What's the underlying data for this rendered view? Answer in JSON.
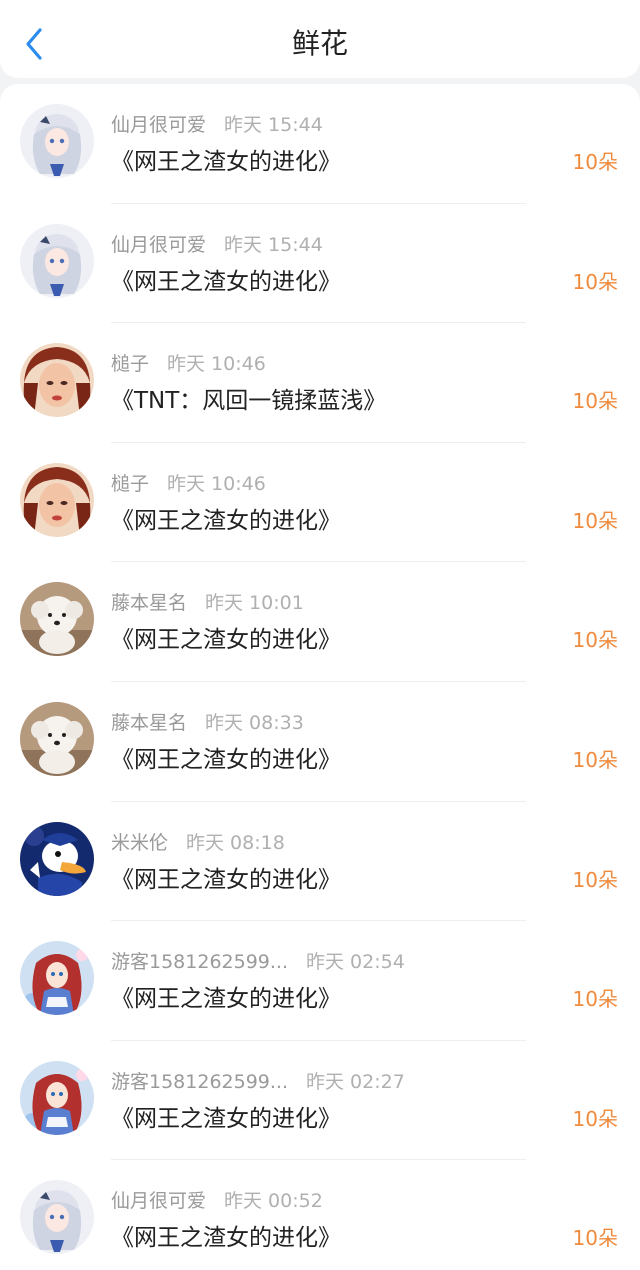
{
  "header": {
    "title": "鲜花"
  },
  "colors": {
    "accent": "#2b8cf0",
    "amount": "#f08a3c"
  },
  "items": [
    {
      "user": "仙月很可爱",
      "time": "昨天 15:44",
      "work": "《网王之渣女的进化》",
      "amount": "10朵",
      "avatar": "anime-girl-white-hair-avatar"
    },
    {
      "user": "仙月很可爱",
      "time": "昨天 15:44",
      "work": "《网王之渣女的进化》",
      "amount": "10朵",
      "avatar": "anime-girl-white-hair-avatar"
    },
    {
      "user": "槌子",
      "time": "昨天 10:46",
      "work": "《TNT：风回一镜揉蓝浅》",
      "amount": "10朵",
      "avatar": "painted-girl-avatar"
    },
    {
      "user": "槌子",
      "time": "昨天 10:46",
      "work": "《网王之渣女的进化》",
      "amount": "10朵",
      "avatar": "painted-girl-avatar"
    },
    {
      "user": "藤本星名",
      "time": "昨天 10:01",
      "work": "《网王之渣女的进化》",
      "amount": "10朵",
      "avatar": "white-puppy-avatar"
    },
    {
      "user": "藤本星名",
      "time": "昨天 08:33",
      "work": "《网王之渣女的进化》",
      "amount": "10朵",
      "avatar": "white-puppy-avatar"
    },
    {
      "user": "米米伦",
      "time": "昨天 08:18",
      "work": "《网王之渣女的进化》",
      "amount": "10朵",
      "avatar": "cartoon-duck-avatar"
    },
    {
      "user": "游客1581262599...",
      "time": "昨天 02:54",
      "work": "《网王之渣女的进化》",
      "amount": "10朵",
      "avatar": "anime-girl-red-hair-avatar"
    },
    {
      "user": "游客1581262599...",
      "time": "昨天 02:27",
      "work": "《网王之渣女的进化》",
      "amount": "10朵",
      "avatar": "anime-girl-red-hair-avatar"
    },
    {
      "user": "仙月很可爱",
      "time": "昨天 00:52",
      "work": "《网王之渣女的进化》",
      "amount": "10朵",
      "avatar": "anime-girl-white-hair-avatar"
    }
  ]
}
